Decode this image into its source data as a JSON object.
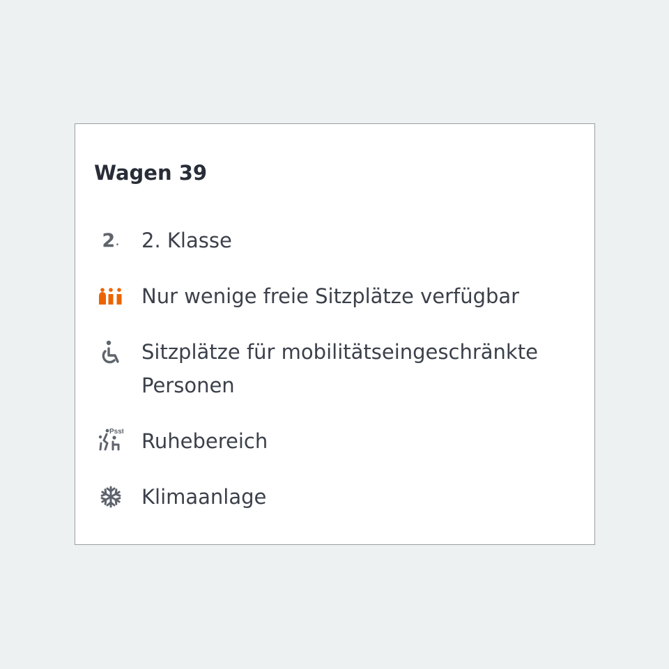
{
  "card": {
    "title": "Wagen 39",
    "features": [
      {
        "icon": "second-class-icon",
        "icon_text": "2",
        "label": "2. Klasse"
      },
      {
        "icon": "occupancy-high-icon",
        "icon_color": "#ec6400",
        "label": "Nur wenige freie Sitzplätze verfügbar"
      },
      {
        "icon": "wheelchair-icon",
        "label": "Sitzplätze für mobilitätseingeschränkte Personen"
      },
      {
        "icon": "quiet-zone-icon",
        "icon_text": "Psst",
        "label": "Ruhebereich"
      },
      {
        "icon": "snowflake-icon",
        "label": "Klimaanlage"
      }
    ]
  },
  "colors": {
    "background": "#eef1f2",
    "card_border": "#9a9ea3",
    "text": "#3b404a",
    "icon_gray": "#5e636c",
    "accent_orange": "#ec6400"
  }
}
